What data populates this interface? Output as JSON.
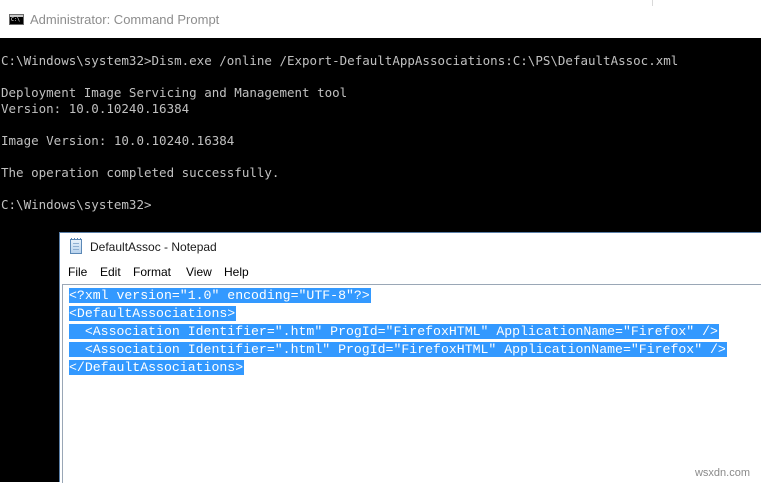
{
  "cmd": {
    "title": "Administrator: Command Prompt",
    "icon": "cmd-icon",
    "lines": [
      "C:\\Windows\\system32>Dism.exe /online /Export-DefaultAppAssociations:C:\\PS\\DefaultAssoc.xml",
      "",
      "Deployment Image Servicing and Management tool",
      "Version: 10.0.10240.16384",
      "",
      "Image Version: 10.0.10240.16384",
      "",
      "The operation completed successfully.",
      "",
      "C:\\Windows\\system32>"
    ]
  },
  "notepad": {
    "title": "DefaultAssoc - Notepad",
    "icon": "notepad-icon",
    "menu": [
      "File",
      "Edit",
      "Format",
      "View",
      "Help"
    ],
    "content_lines": [
      "<?xml version=\"1.0\" encoding=\"UTF-8\"?>",
      "<DefaultAssociations>",
      "  <Association Identifier=\".htm\" ProgId=\"FirefoxHTML\" ApplicationName=\"Firefox\" />",
      "  <Association Identifier=\".html\" ProgId=\"FirefoxHTML\" ApplicationName=\"Firefox\" />",
      "</DefaultAssociations>"
    ],
    "selection_color": "#3399ff"
  },
  "watermark": "wsxdn.com"
}
